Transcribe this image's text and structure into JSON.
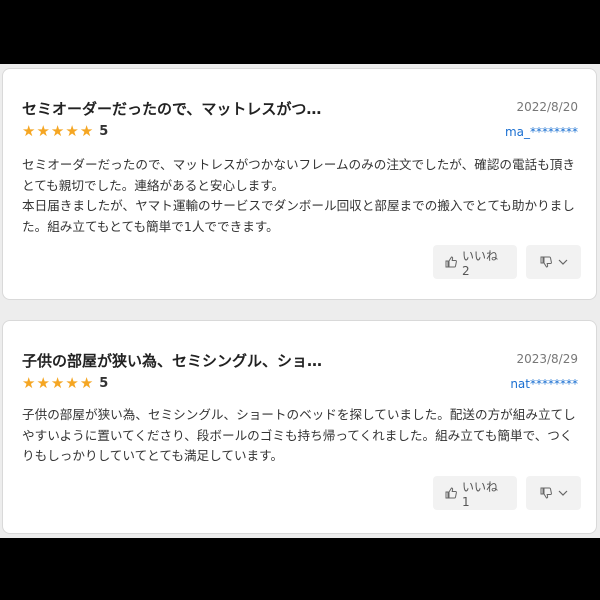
{
  "reviews": [
    {
      "title": "セミオーダーだったので、マットレスがつ…",
      "date": "2022/8/20",
      "rating": "5",
      "user": "ma_********",
      "body": "セミオーダーだったので、マットレスがつかないフレームのみの注文でしたが、確認の電話も頂きとても親切でした。連絡があると安心します。\n本日届きましたが、ヤマト運輸のサービスでダンボール回収と部屋までの搬入でとても助かりました。組み立てもとても簡単で1人でできます。",
      "like_label": "いいね 2"
    },
    {
      "title": "子供の部屋が狭い為、セミシングル、ショ…",
      "date": "2023/8/29",
      "rating": "5",
      "user": "nat********",
      "body": "子供の部屋が狭い為、セミシングル、ショートのベッドを探していました。配送の方が組み立てしやすいように置いてくださり、段ボールのゴミも持ち帰ってくれました。組み立ても簡単で、つくりもしっかりしていてとても満足しています。",
      "like_label": "いいね 1"
    }
  ],
  "colors": {
    "star": "#f5a623",
    "user_link": "#1a6fd1",
    "button_bg": "#f2f2f2"
  },
  "icons": {
    "like": "thumbs-up-icon",
    "dislike": "thumbs-down-icon",
    "dropdown": "chevron-down-icon",
    "star": "star-icon"
  }
}
